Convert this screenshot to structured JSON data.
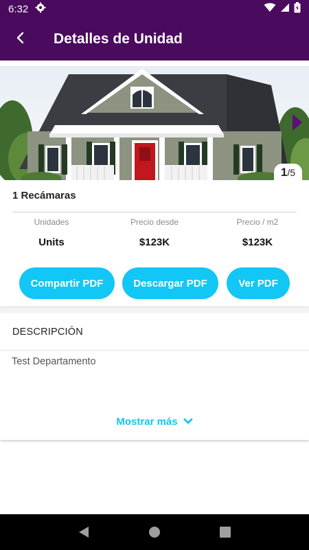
{
  "status_bar": {
    "time": "6:32"
  },
  "app_bar": {
    "title": "Detalles de Unidad"
  },
  "gallery": {
    "current": "1",
    "total": "/5"
  },
  "unit": {
    "title": "1 Recámaras",
    "stats": [
      {
        "label": "Unidades",
        "value": "Units"
      },
      {
        "label": "Precio desde",
        "value": "$123K"
      },
      {
        "label": "Precio / m2",
        "value": "$123K"
      }
    ]
  },
  "buttons": {
    "share_pdf": "Compartir PDF",
    "download_pdf": "Descargar PDF",
    "view_pdf": "Ver PDF"
  },
  "description": {
    "heading": "DESCRIPCIÓN",
    "text": "Test Departamento",
    "show_more": "Mostrar más"
  },
  "colors": {
    "primary": "#4a0a5e",
    "accent": "#12c6f5"
  }
}
